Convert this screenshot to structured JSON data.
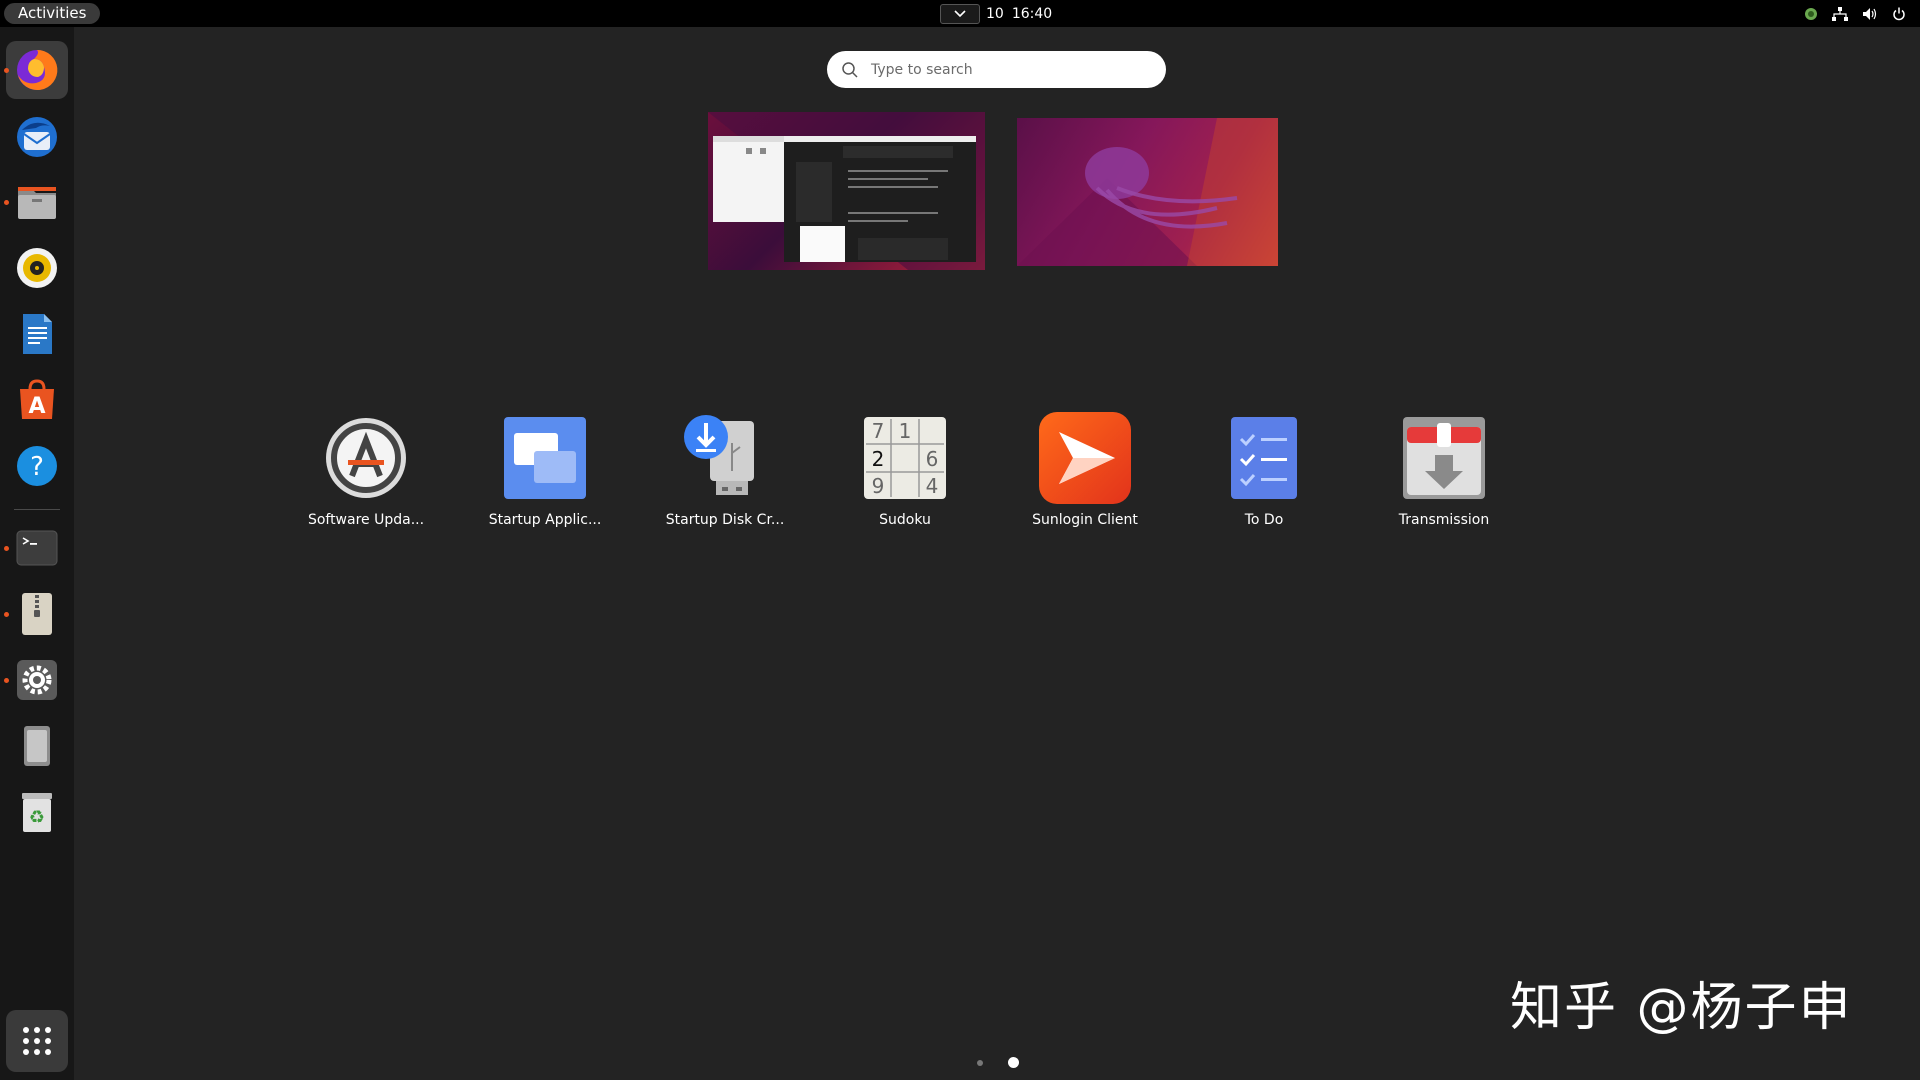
{
  "topbar": {
    "activities": "Activities",
    "clock_day": "10",
    "clock_time": "16:40"
  },
  "dock": {
    "items": [
      {
        "name": "Firefox",
        "icon": "firefox-icon"
      },
      {
        "name": "Thunderbird",
        "icon": "thunderbird-icon"
      },
      {
        "name": "Files",
        "icon": "files-icon"
      },
      {
        "name": "Rhythmbox",
        "icon": "rhythmbox-icon"
      },
      {
        "name": "LibreOffice Writer",
        "icon": "writer-icon"
      },
      {
        "name": "Ubuntu Software",
        "icon": "software-icon"
      },
      {
        "name": "Help",
        "icon": "help-icon"
      },
      {
        "name": "Terminal",
        "icon": "terminal-icon"
      },
      {
        "name": "Archive Manager",
        "icon": "archive-icon"
      },
      {
        "name": "Settings",
        "icon": "settings-icon"
      },
      {
        "name": "Removable Drive",
        "icon": "drive-icon"
      },
      {
        "name": "Trash",
        "icon": "trash-icon"
      }
    ]
  },
  "search": {
    "placeholder": "Type to search"
  },
  "apps": [
    {
      "label": "Software Upda...",
      "icon": "software-updater-icon"
    },
    {
      "label": "Startup Applic...",
      "icon": "startup-applications-icon"
    },
    {
      "label": "Startup Disk Cr...",
      "icon": "startup-disk-creator-icon"
    },
    {
      "label": "Sudoku",
      "icon": "sudoku-icon"
    },
    {
      "label": "Sunlogin Client",
      "icon": "sunlogin-icon"
    },
    {
      "label": "To Do",
      "icon": "todo-icon"
    },
    {
      "label": "Transmission",
      "icon": "transmission-icon"
    }
  ],
  "sudoku_digits": [
    "7",
    "1",
    "2",
    "6",
    "9",
    "4"
  ],
  "pages": {
    "count": 2,
    "current": 2
  },
  "watermark": "知乎 @杨子申",
  "colors": {
    "accent": "#e95420",
    "background": "#232323",
    "dock": "#171717"
  }
}
